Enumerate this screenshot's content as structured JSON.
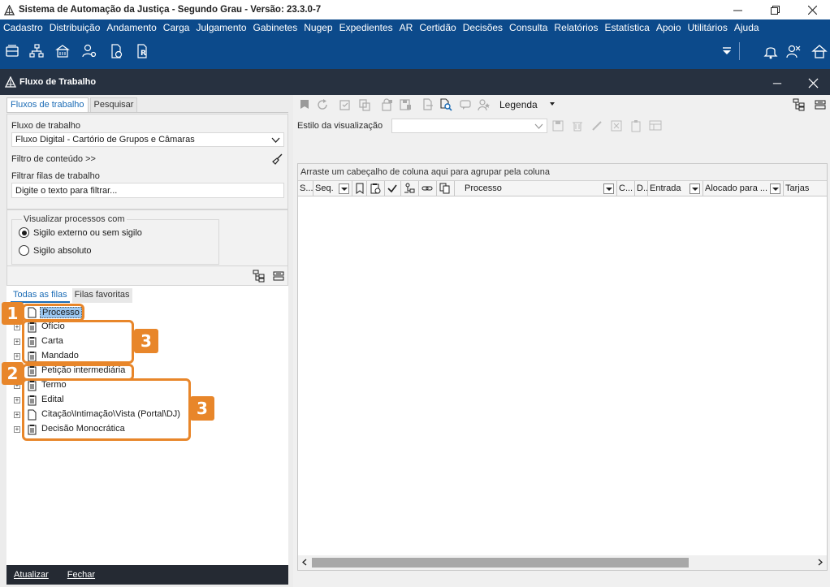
{
  "app": {
    "title": "Sistema de Automação da Justiça - Segundo Grau - Versão: 23.3.0-7"
  },
  "menu": [
    "Cadastro",
    "Distribuição",
    "Andamento",
    "Carga",
    "Julgamento",
    "Gabinetes",
    "Nugep",
    "Expedientes",
    "AR",
    "Certidão",
    "Decisões",
    "Consulta",
    "Relatórios",
    "Estatística",
    "Apoio",
    "Utilitários",
    "Ajuda"
  ],
  "window": {
    "title": "Fluxo de Trabalho"
  },
  "left": {
    "tabs": [
      "Fluxos de trabalho",
      "Pesquisar"
    ],
    "flow_label": "Fluxo de trabalho",
    "flow_value": "Fluxo Digital - Cartório de Grupos e Câmaras",
    "content_filter": "Filtro de conteúdo >>",
    "queue_filter_label": "Filtrar filas de trabalho",
    "queue_filter_placeholder": "Digite o texto para filtrar...",
    "sigilo_title": "Visualizar processos com",
    "sigilo_options": [
      "Sigilo externo ou sem sigilo",
      "Sigilo absoluto"
    ],
    "sigilo_selected": 0,
    "tree_tabs": [
      "Todas as filas",
      "Filas favoritas"
    ],
    "tree": [
      {
        "label": "Processo",
        "icon": "document-icon",
        "expandable": false,
        "selected": true
      },
      {
        "label": "Ofício",
        "icon": "clipboard-icon",
        "expandable": true
      },
      {
        "label": "Carta",
        "icon": "clipboard-icon",
        "expandable": true
      },
      {
        "label": "Mandado",
        "icon": "clipboard-icon",
        "expandable": true
      },
      {
        "label": "Petição intermediária",
        "icon": "clipboard-icon",
        "expandable": false
      },
      {
        "label": "Termo",
        "icon": "clipboard-icon",
        "expandable": true
      },
      {
        "label": "Edital",
        "icon": "clipboard-icon",
        "expandable": true
      },
      {
        "label": "Citação\\Intimação\\Vista (Portal\\DJ)",
        "icon": "document-icon",
        "expandable": true
      },
      {
        "label": "Decisão Monocrática",
        "icon": "clipboard-icon",
        "expandable": true
      }
    ],
    "bottom": {
      "update": "Atualizar",
      "close": "Fechar"
    }
  },
  "right": {
    "legend": "Legenda",
    "view_style_label": "Estilo da visualização",
    "group_hint": "Arraste um cabeçalho de coluna aqui para agrupar pela coluna",
    "columns": {
      "s": "S...",
      "seq": "Seq.",
      "processo": "Processo",
      "c": "C...",
      "d": "D...",
      "entrada": "Entrada",
      "alocado": "Alocado para ...",
      "tarjas": "Tarjas"
    }
  },
  "callouts": [
    {
      "label": "1",
      "target": "Processo"
    },
    {
      "label": "2",
      "target": "Petição intermediária"
    },
    {
      "label": "3",
      "target": "Ofício, Carta, Mandado"
    },
    {
      "label": "3",
      "target": "Termo, Edital, Citação, Decisão"
    }
  ],
  "colors": {
    "menubar": "#0c4a8b",
    "window_header": "#273140",
    "accent": "#1a6bb5",
    "callout": "#e8862a"
  }
}
